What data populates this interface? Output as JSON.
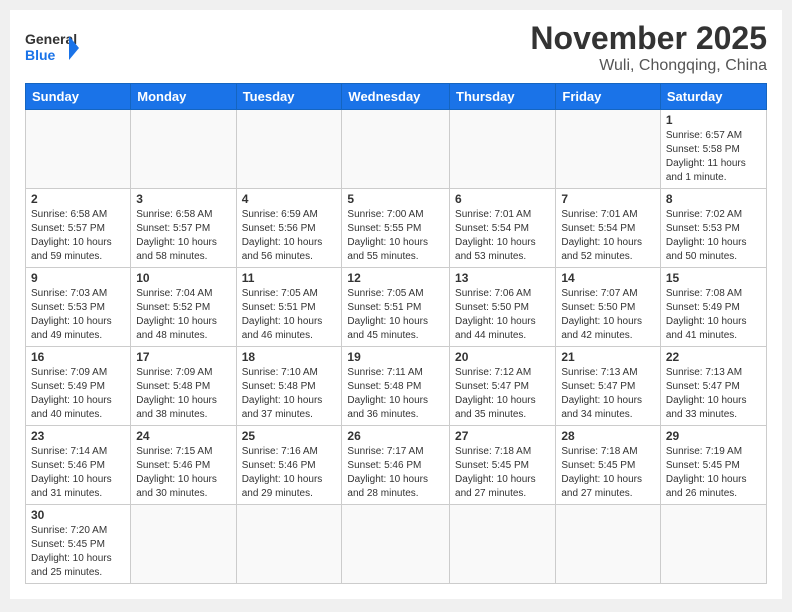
{
  "header": {
    "logo_general": "General",
    "logo_blue": "Blue",
    "month_title": "November 2025",
    "location": "Wuli, Chongqing, China"
  },
  "weekdays": [
    "Sunday",
    "Monday",
    "Tuesday",
    "Wednesday",
    "Thursday",
    "Friday",
    "Saturday"
  ],
  "weeks": [
    [
      {
        "day": "",
        "info": ""
      },
      {
        "day": "",
        "info": ""
      },
      {
        "day": "",
        "info": ""
      },
      {
        "day": "",
        "info": ""
      },
      {
        "day": "",
        "info": ""
      },
      {
        "day": "",
        "info": ""
      },
      {
        "day": "1",
        "info": "Sunrise: 6:57 AM\nSunset: 5:58 PM\nDaylight: 11 hours and 1 minute."
      }
    ],
    [
      {
        "day": "2",
        "info": "Sunrise: 6:58 AM\nSunset: 5:57 PM\nDaylight: 10 hours and 59 minutes."
      },
      {
        "day": "3",
        "info": "Sunrise: 6:58 AM\nSunset: 5:57 PM\nDaylight: 10 hours and 58 minutes."
      },
      {
        "day": "4",
        "info": "Sunrise: 6:59 AM\nSunset: 5:56 PM\nDaylight: 10 hours and 56 minutes."
      },
      {
        "day": "5",
        "info": "Sunrise: 7:00 AM\nSunset: 5:55 PM\nDaylight: 10 hours and 55 minutes."
      },
      {
        "day": "6",
        "info": "Sunrise: 7:01 AM\nSunset: 5:54 PM\nDaylight: 10 hours and 53 minutes."
      },
      {
        "day": "7",
        "info": "Sunrise: 7:01 AM\nSunset: 5:54 PM\nDaylight: 10 hours and 52 minutes."
      },
      {
        "day": "8",
        "info": "Sunrise: 7:02 AM\nSunset: 5:53 PM\nDaylight: 10 hours and 50 minutes."
      }
    ],
    [
      {
        "day": "9",
        "info": "Sunrise: 7:03 AM\nSunset: 5:53 PM\nDaylight: 10 hours and 49 minutes."
      },
      {
        "day": "10",
        "info": "Sunrise: 7:04 AM\nSunset: 5:52 PM\nDaylight: 10 hours and 48 minutes."
      },
      {
        "day": "11",
        "info": "Sunrise: 7:05 AM\nSunset: 5:51 PM\nDaylight: 10 hours and 46 minutes."
      },
      {
        "day": "12",
        "info": "Sunrise: 7:05 AM\nSunset: 5:51 PM\nDaylight: 10 hours and 45 minutes."
      },
      {
        "day": "13",
        "info": "Sunrise: 7:06 AM\nSunset: 5:50 PM\nDaylight: 10 hours and 44 minutes."
      },
      {
        "day": "14",
        "info": "Sunrise: 7:07 AM\nSunset: 5:50 PM\nDaylight: 10 hours and 42 minutes."
      },
      {
        "day": "15",
        "info": "Sunrise: 7:08 AM\nSunset: 5:49 PM\nDaylight: 10 hours and 41 minutes."
      }
    ],
    [
      {
        "day": "16",
        "info": "Sunrise: 7:09 AM\nSunset: 5:49 PM\nDaylight: 10 hours and 40 minutes."
      },
      {
        "day": "17",
        "info": "Sunrise: 7:09 AM\nSunset: 5:48 PM\nDaylight: 10 hours and 38 minutes."
      },
      {
        "day": "18",
        "info": "Sunrise: 7:10 AM\nSunset: 5:48 PM\nDaylight: 10 hours and 37 minutes."
      },
      {
        "day": "19",
        "info": "Sunrise: 7:11 AM\nSunset: 5:48 PM\nDaylight: 10 hours and 36 minutes."
      },
      {
        "day": "20",
        "info": "Sunrise: 7:12 AM\nSunset: 5:47 PM\nDaylight: 10 hours and 35 minutes."
      },
      {
        "day": "21",
        "info": "Sunrise: 7:13 AM\nSunset: 5:47 PM\nDaylight: 10 hours and 34 minutes."
      },
      {
        "day": "22",
        "info": "Sunrise: 7:13 AM\nSunset: 5:47 PM\nDaylight: 10 hours and 33 minutes."
      }
    ],
    [
      {
        "day": "23",
        "info": "Sunrise: 7:14 AM\nSunset: 5:46 PM\nDaylight: 10 hours and 31 minutes."
      },
      {
        "day": "24",
        "info": "Sunrise: 7:15 AM\nSunset: 5:46 PM\nDaylight: 10 hours and 30 minutes."
      },
      {
        "day": "25",
        "info": "Sunrise: 7:16 AM\nSunset: 5:46 PM\nDaylight: 10 hours and 29 minutes."
      },
      {
        "day": "26",
        "info": "Sunrise: 7:17 AM\nSunset: 5:46 PM\nDaylight: 10 hours and 28 minutes."
      },
      {
        "day": "27",
        "info": "Sunrise: 7:18 AM\nSunset: 5:45 PM\nDaylight: 10 hours and 27 minutes."
      },
      {
        "day": "28",
        "info": "Sunrise: 7:18 AM\nSunset: 5:45 PM\nDaylight: 10 hours and 27 minutes."
      },
      {
        "day": "29",
        "info": "Sunrise: 7:19 AM\nSunset: 5:45 PM\nDaylight: 10 hours and 26 minutes."
      }
    ],
    [
      {
        "day": "30",
        "info": "Sunrise: 7:20 AM\nSunset: 5:45 PM\nDaylight: 10 hours and 25 minutes."
      },
      {
        "day": "",
        "info": ""
      },
      {
        "day": "",
        "info": ""
      },
      {
        "day": "",
        "info": ""
      },
      {
        "day": "",
        "info": ""
      },
      {
        "day": "",
        "info": ""
      },
      {
        "day": "",
        "info": ""
      }
    ]
  ]
}
